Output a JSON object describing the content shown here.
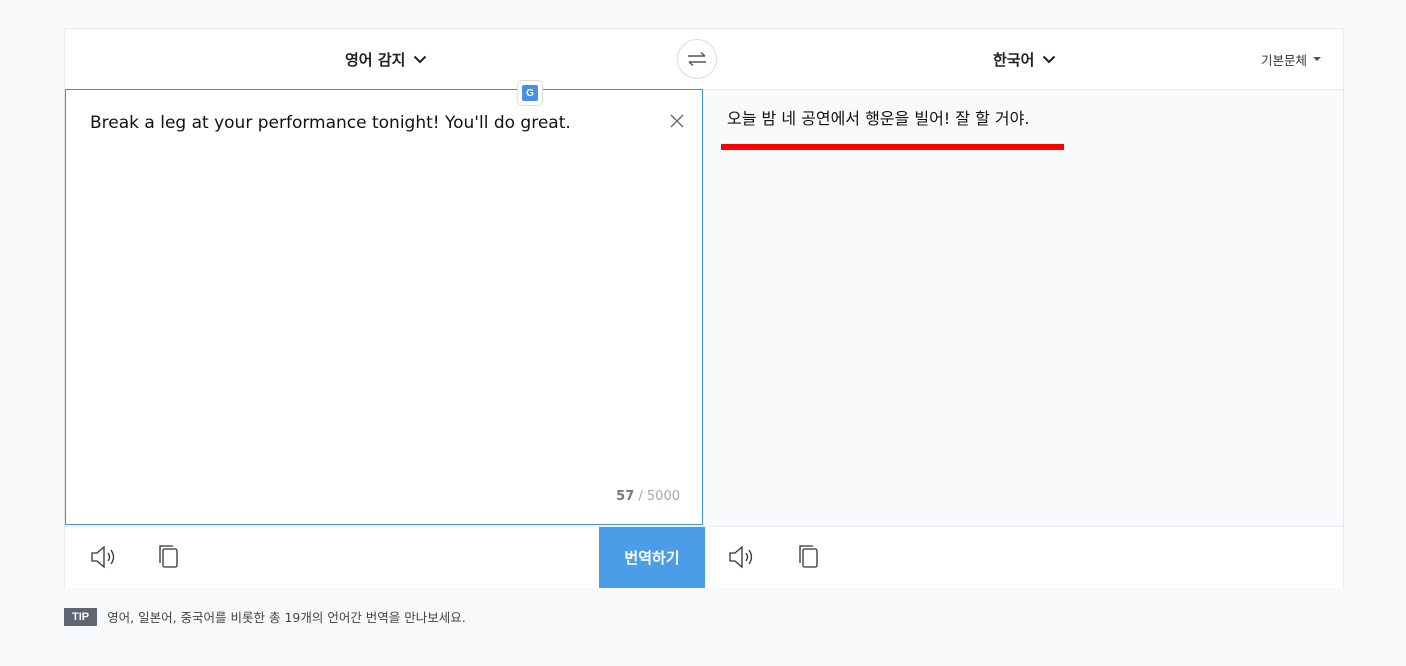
{
  "header": {
    "source_language": "영어 감지",
    "target_language": "한국어",
    "font_option": "기본문체"
  },
  "icons": {
    "swap": "swap-arrows-icon",
    "source_chevron": "chevron-down-icon",
    "target_chevron": "chevron-down-icon",
    "font_caret": "caret-down-icon",
    "clear": "close-icon",
    "google": "google-translate-icon",
    "speaker": "speaker-icon",
    "copy": "copy-icon"
  },
  "google_badge_letter": "G",
  "source": {
    "text": "Break a leg at your performance tonight! You'll do great.",
    "char_count": "57",
    "char_limit": "/ 5000"
  },
  "target": {
    "text": "오늘 밤 네 공연에서 행운을 빌어! 잘 할 거야."
  },
  "actions": {
    "translate_label": "번역하기"
  },
  "tip": {
    "badge": "TIP",
    "text": "영어, 일본어, 중국어를 비롯한 총 19개의 언어간 번역을 만나보세요."
  },
  "colors": {
    "accent": "#4a9de6",
    "highlight_underline": "#ff0000",
    "source_border": "#3b95dc"
  }
}
